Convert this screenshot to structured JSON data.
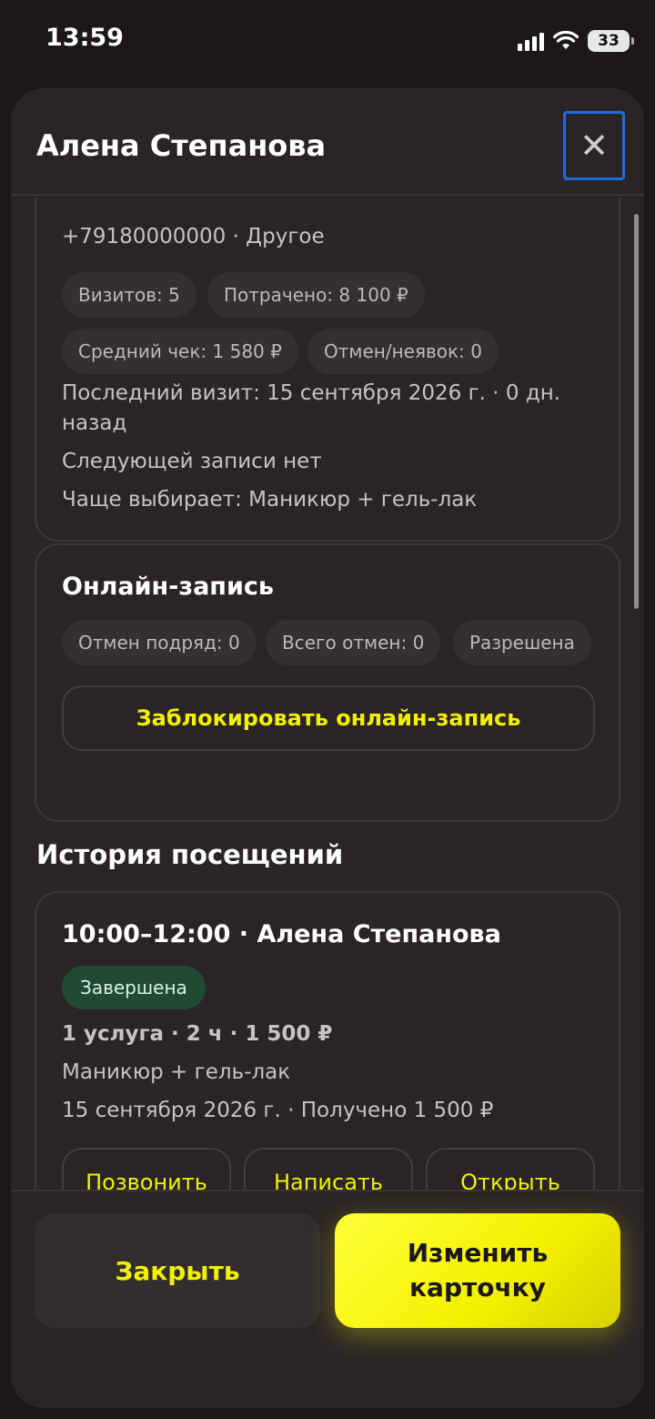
{
  "status_bar": {
    "time": "13:59",
    "battery": "33"
  },
  "sheet": {
    "title": "Алена Степанова",
    "close_icon": "✕"
  },
  "client_info": {
    "phone_line": "+79180000000 · Другое",
    "chips": [
      "Визитов: 5",
      "Потрачено: 8 100 ₽",
      "Средний чек: 1 580 ₽",
      "Отмен/неявок: 0"
    ],
    "last_visit_line1": "Последний визит: 15 сентября 2026 г. · 0 дн.",
    "last_visit_line2": "назад",
    "next_booking": "Следующей записи нет",
    "favorite": "Чаще выбирает: Маникюр + гель-лак"
  },
  "online_booking": {
    "title": "Онлайн-запись",
    "chips": [
      "Отмен подряд: 0",
      "Всего отмен: 0",
      "Разрешена"
    ],
    "block_button": "Заблокировать онлайн-запись"
  },
  "history": {
    "title": "История посещений",
    "visit": {
      "header": "10:00–12:00 · Алена Степанова",
      "status": "Завершена",
      "summary": "1 услуга · 2 ч · 1 500 ₽",
      "service": "Маникюр + гель-лак",
      "date_line": "15 сентября 2026 г. · Получено 1 500 ₽",
      "actions": [
        "Позвонить",
        "Написать",
        "Открыть"
      ]
    }
  },
  "footer": {
    "close_label": "Закрыть",
    "edit_label": "Изменить карточку"
  },
  "colors": {
    "accent": "#f2f000",
    "background": "#2a2426",
    "status_completed": "#214a35"
  }
}
